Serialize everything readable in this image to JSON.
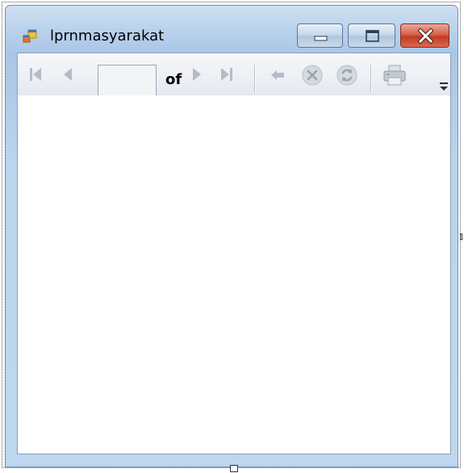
{
  "window": {
    "title": "lprnmasyarakat",
    "icon": "form-window-icon",
    "buttons": {
      "minimize": "minimize-icon",
      "maximize": "maximize-icon",
      "close": "close-icon"
    },
    "colors": {
      "frame": "#b9d2ec",
      "close_button": "#c43a22"
    }
  },
  "toolbar": {
    "first_page": "first-page-icon",
    "previous_page": "previous-page-icon",
    "page_input_value": "",
    "of_label": "of",
    "next_page": "next-page-icon",
    "last_page": "last-page-icon",
    "back": "back-arrow-icon",
    "stop": "stop-icon",
    "refresh": "refresh-icon",
    "print": "print-icon",
    "overflow": "overflow-chevron-icon"
  }
}
